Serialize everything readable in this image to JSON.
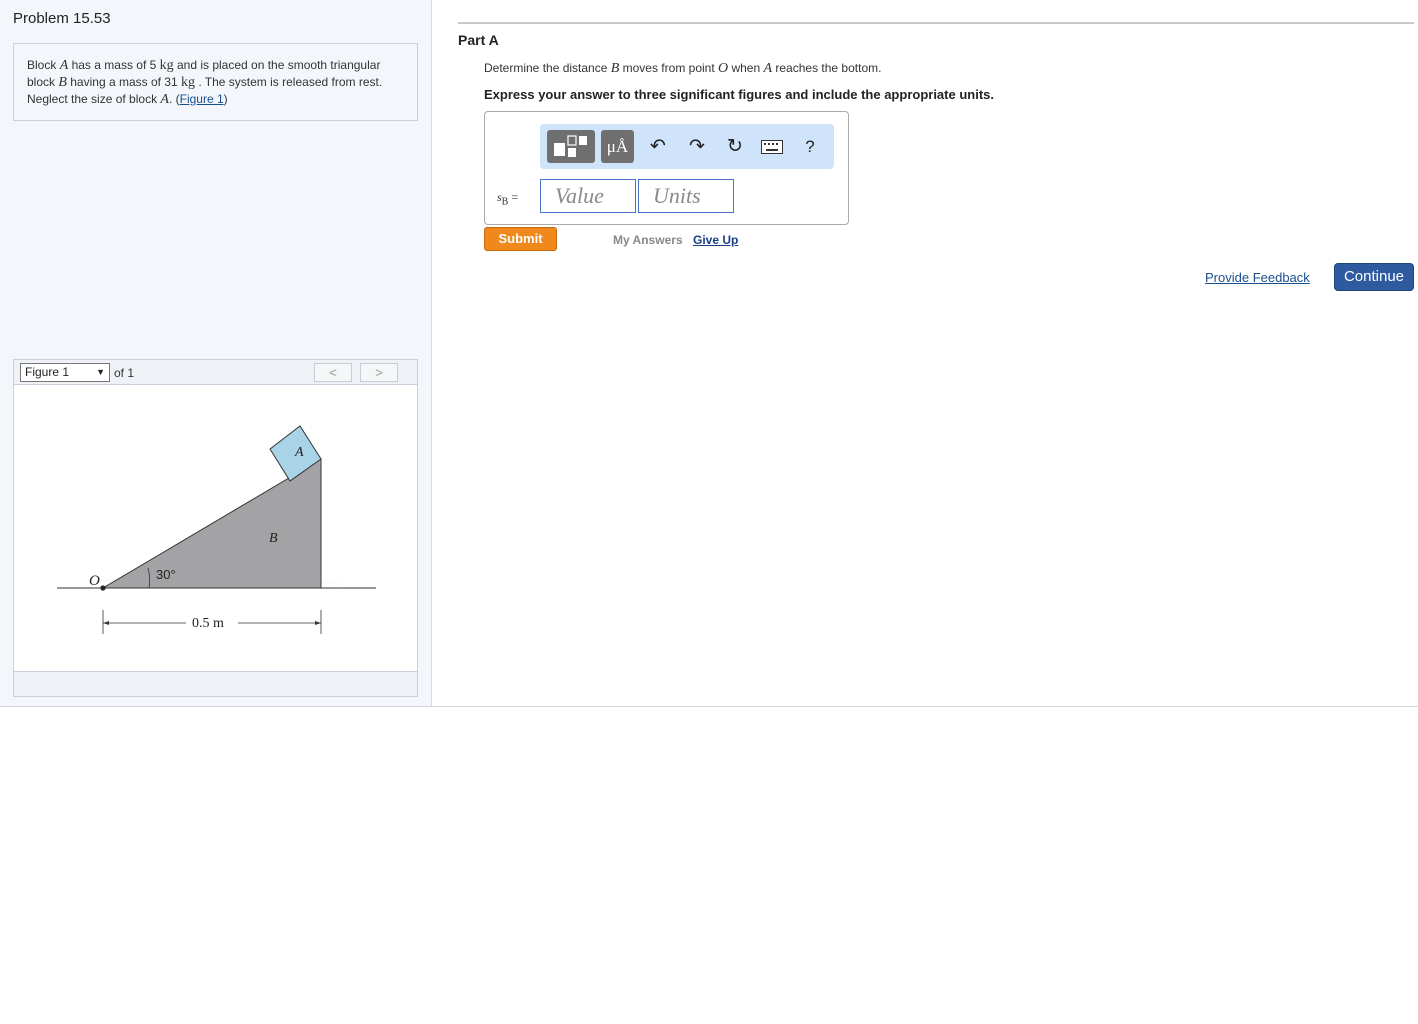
{
  "problem": {
    "title": "Problem 15.53",
    "text": {
      "t1": "Block ",
      "var_a": "A",
      "t2": " has a mass of 5 ",
      "unit_kg": "kg",
      "t3": " and is placed on the smooth triangular block ",
      "var_b": "B",
      "t4": " having a mass of 31 ",
      "unit_kg2": "kg",
      "t5": " . The system is released from rest. Neglect the size of block ",
      "var_a2": "A",
      "t6": ". (",
      "link": "Figure 1",
      "t7": ")"
    }
  },
  "figure": {
    "selected": "Figure 1",
    "of_label": "of 1",
    "prev": "<",
    "next": ">",
    "labels": {
      "block_a": "A",
      "block_b": "B",
      "point_o": "O",
      "angle": "30°",
      "distance": "0.5 m"
    },
    "colors": {
      "block_a": "#a9d3e6",
      "block_b": "#a3a3a6"
    }
  },
  "part": {
    "title": "Part A",
    "question": {
      "q1": "Determine the distance ",
      "var_b": "B",
      "q2": " moves from point ",
      "var_o": "O",
      "q3": " when ",
      "var_a": "A",
      "q4": " reaches the bottom."
    },
    "instructions": "Express your answer to three significant figures and include the appropriate units.",
    "toolbar": {
      "units_button": "μÅ",
      "help": "?",
      "icons": [
        "templates-icon",
        "units-icon",
        "undo-icon",
        "redo-icon",
        "reset-icon",
        "keyboard-icon",
        "help-icon"
      ]
    },
    "answer": {
      "label_var": "s",
      "label_sub": "B",
      "label_eq": " =",
      "value_placeholder": "Value",
      "units_placeholder": "Units"
    },
    "submit": "Submit",
    "my_answers": "My Answers",
    "give_up": "Give Up"
  },
  "footer": {
    "feedback": "Provide Feedback",
    "continue": "Continue"
  },
  "colors": {
    "submit": "#f0891c",
    "continue": "#2e5aa0",
    "toolbar_bg": "#cfe3fb",
    "left_panel_bg": "#f3f7fc"
  }
}
